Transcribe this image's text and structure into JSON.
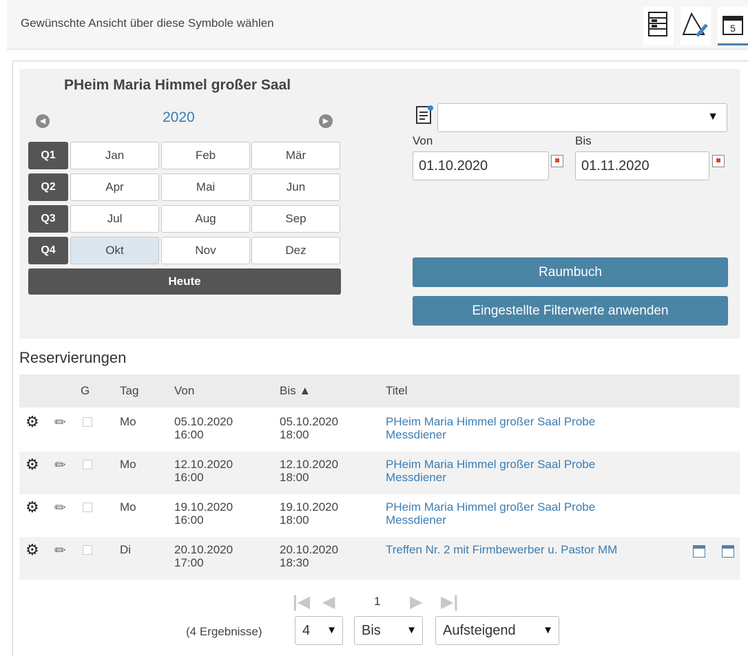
{
  "header": {
    "hint": "Gewünschte Ansicht über diese Symbole wählen",
    "views": [
      {
        "icon": "list-view-icon"
      },
      {
        "icon": "edit-view-icon"
      },
      {
        "icon": "calendar-view-icon",
        "active": true
      }
    ]
  },
  "calendar": {
    "room": "PHeim Maria Himmel großer Saal",
    "year": "2020",
    "quarters": [
      "Q1",
      "Q2",
      "Q3",
      "Q4"
    ],
    "months": [
      "Jan",
      "Feb",
      "Mär",
      "Apr",
      "Mai",
      "Jun",
      "Jul",
      "Aug",
      "Sep",
      "Okt",
      "Nov",
      "Dez"
    ],
    "selected_month": "Okt",
    "today_label": "Heute"
  },
  "filter": {
    "room_select_value": "",
    "von_label": "Von",
    "bis_label": "Bis",
    "von_value": "01.10.2020",
    "bis_value": "01.11.2020",
    "raumbuch_label": "Raumbuch",
    "apply_label": "Eingestellte Filterwerte anwenden"
  },
  "reservations": {
    "title": "Reservierungen",
    "columns": [
      "G",
      "Tag",
      "Von",
      "Bis ▲",
      "Titel"
    ],
    "rows": [
      {
        "tag": "Mo",
        "von_date": "05.10.2020",
        "von_time": "16:00",
        "bis_date": "05.10.2020",
        "bis_time": "18:00",
        "title_1": "PHeim Maria Himmel großer Saal Probe",
        "title_2": "Messdiener"
      },
      {
        "tag": "Mo",
        "von_date": "12.10.2020",
        "von_time": "16:00",
        "bis_date": "12.10.2020",
        "bis_time": "18:00",
        "title_1": "PHeim Maria Himmel großer Saal Probe",
        "title_2": "Messdiener"
      },
      {
        "tag": "Mo",
        "von_date": "19.10.2020",
        "von_time": "16:00",
        "bis_date": "19.10.2020",
        "bis_time": "18:00",
        "title_1": "PHeim Maria Himmel großer Saal Probe",
        "title_2": "Messdiener"
      },
      {
        "tag": "Di",
        "von_date": "20.10.2020",
        "von_time": "17:00",
        "bis_date": "20.10.2020",
        "bis_time": "18:30",
        "title_1": "Treffen Nr. 2 mit Firmbewerber u. Pastor MM",
        "title_2": ""
      }
    ]
  },
  "pagination": {
    "page": "1",
    "results": "(4 Ergebnisse)",
    "page_size": "4",
    "sort_field": "Bis",
    "sort_order": "Aufsteigend"
  }
}
